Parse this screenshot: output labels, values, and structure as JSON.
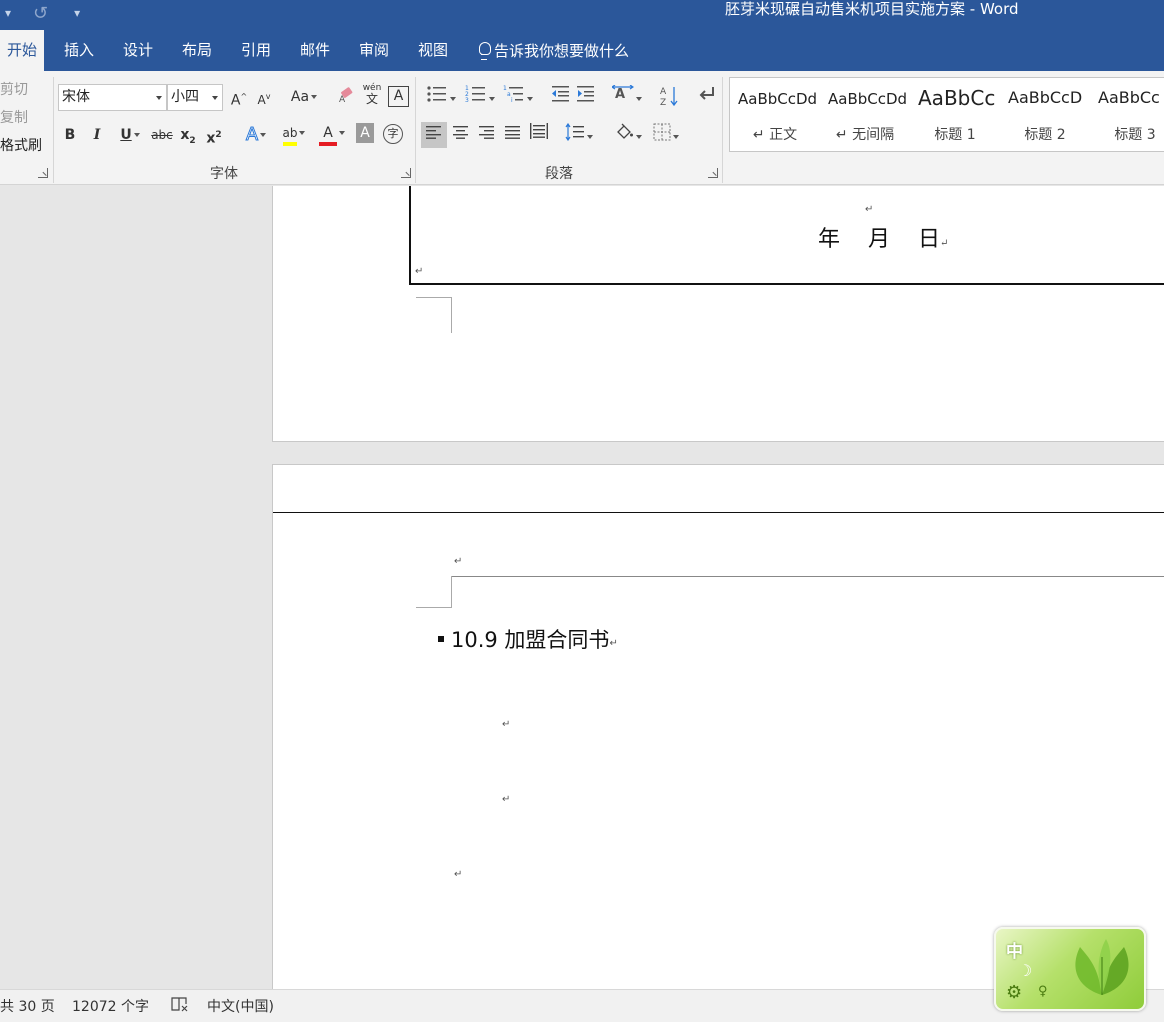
{
  "titlebar": {
    "undo_label": "▾",
    "redo_icon": "↺",
    "customize_label": "▾",
    "doc_title": "胚芽米现碾自动售米机项目实施方案  -  Word"
  },
  "tabs": [
    {
      "label": "开始",
      "active": true
    },
    {
      "label": "插入"
    },
    {
      "label": "设计"
    },
    {
      "label": "布局"
    },
    {
      "label": "引用"
    },
    {
      "label": "邮件"
    },
    {
      "label": "审阅"
    },
    {
      "label": "视图"
    }
  ],
  "tell_me": "告诉我你想要做什么",
  "clipboard": {
    "cut": "剪切",
    "copy": "复制",
    "format_painter": "格式刷"
  },
  "font_group": {
    "font_name": "宋体",
    "font_size": "小四",
    "grow": "A",
    "shrink": "A",
    "change_case": "Aa",
    "phonetic_top": "wén",
    "phonetic_bottom": "文",
    "char_border": "A",
    "bold": "B",
    "italic": "I",
    "underline": "U",
    "strike": "abc",
    "subscript": "x",
    "sub_mark": "2",
    "superscript": "x",
    "sup_mark": "2",
    "text_effect": "A",
    "highlight": "ab",
    "font_color": "A",
    "char_shading": "A",
    "enclose": "字",
    "label": "字体"
  },
  "paragraph_group": {
    "label": "段落",
    "sort": "A↓"
  },
  "styles": [
    {
      "sample": "AaBbCcDd",
      "name": "↵ 正文",
      "size": "15px"
    },
    {
      "sample": "AaBbCcDd",
      "name": "↵ 无间隔",
      "size": "15px"
    },
    {
      "sample": "AaBbCc",
      "name": "标题 1",
      "size": "20px"
    },
    {
      "sample": "AaBbCcD",
      "name": "标题 2",
      "size": "17px"
    },
    {
      "sample": "AaBbCc",
      "name": "标题 3",
      "size": "17px"
    }
  ],
  "document": {
    "date_text": "年    月    日",
    "heading": "10.9 加盟合同书",
    "para_mark": "↵"
  },
  "status": {
    "pages": "共 30 页",
    "words": "12072 个字",
    "language": "中文(中国)"
  },
  "ime": {
    "label": "中",
    "moon": "☽",
    "gear": "⚙",
    "key": "♀"
  },
  "colors": {
    "brand": "#2b579a",
    "highlight_yellow": "#ffff00",
    "font_red": "#e51c23"
  }
}
